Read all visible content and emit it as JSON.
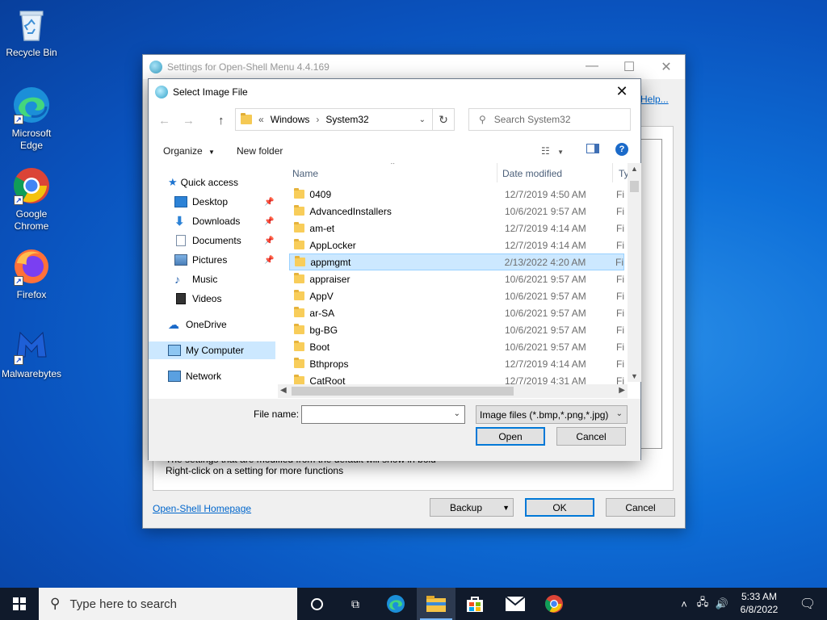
{
  "desktop": {
    "icons": [
      {
        "label": "Recycle Bin"
      },
      {
        "label": "Microsoft Edge"
      },
      {
        "label": "Google Chrome"
      },
      {
        "label": "Firefox"
      },
      {
        "label": "Malwarebytes"
      }
    ]
  },
  "settings_window": {
    "title": "Settings for Open-Shell Menu 4.4.169",
    "help_link": "Help...",
    "hint_line1": "The settings that are modified from the default will show in bold",
    "hint_line2": "Right-click on a setting for more functions",
    "homepage_link": "Open-Shell Homepage",
    "backup_label": "Backup",
    "ok_label": "OK",
    "cancel_label": "Cancel"
  },
  "dialog": {
    "title": "Select Image File",
    "breadcrumb": {
      "prefix": "«",
      "parts": [
        "Windows",
        "System32"
      ]
    },
    "search_placeholder": "Search System32",
    "organize_label": "Organize",
    "new_folder_label": "New folder",
    "nav": [
      {
        "label": "Quick access"
      },
      {
        "label": "Desktop"
      },
      {
        "label": "Downloads"
      },
      {
        "label": "Documents"
      },
      {
        "label": "Pictures"
      },
      {
        "label": "Music"
      },
      {
        "label": "Videos"
      },
      {
        "label": "OneDrive"
      },
      {
        "label": "My Computer"
      },
      {
        "label": "Network"
      }
    ],
    "columns": {
      "name": "Name",
      "date": "Date modified",
      "type": "Ty"
    },
    "files": [
      {
        "name": "0409",
        "date": "12/7/2019 4:50 AM",
        "type": "Fi"
      },
      {
        "name": "AdvancedInstallers",
        "date": "10/6/2021 9:57 AM",
        "type": "Fi"
      },
      {
        "name": "am-et",
        "date": "12/7/2019 4:14 AM",
        "type": "Fi"
      },
      {
        "name": "AppLocker",
        "date": "12/7/2019 4:14 AM",
        "type": "Fi"
      },
      {
        "name": "appmgmt",
        "date": "2/13/2022 4:20 AM",
        "type": "Fi"
      },
      {
        "name": "appraiser",
        "date": "10/6/2021 9:57 AM",
        "type": "Fi"
      },
      {
        "name": "AppV",
        "date": "10/6/2021 9:57 AM",
        "type": "Fi"
      },
      {
        "name": "ar-SA",
        "date": "10/6/2021 9:57 AM",
        "type": "Fi"
      },
      {
        "name": "bg-BG",
        "date": "10/6/2021 9:57 AM",
        "type": "Fi"
      },
      {
        "name": "Boot",
        "date": "10/6/2021 9:57 AM",
        "type": "Fi"
      },
      {
        "name": "Bthprops",
        "date": "12/7/2019 4:14 AM",
        "type": "Fi"
      },
      {
        "name": "CatRoot",
        "date": "12/7/2019 4:31 AM",
        "type": "Fi"
      }
    ],
    "file_name_label": "File name:",
    "file_name_value": "",
    "filter_label": "Image files (*.bmp,*.png,*.jpg)",
    "open_label": "Open",
    "cancel_label": "Cancel"
  },
  "taskbar": {
    "search_placeholder": "Type here to search",
    "time": "5:33 AM",
    "date": "6/8/2022"
  }
}
